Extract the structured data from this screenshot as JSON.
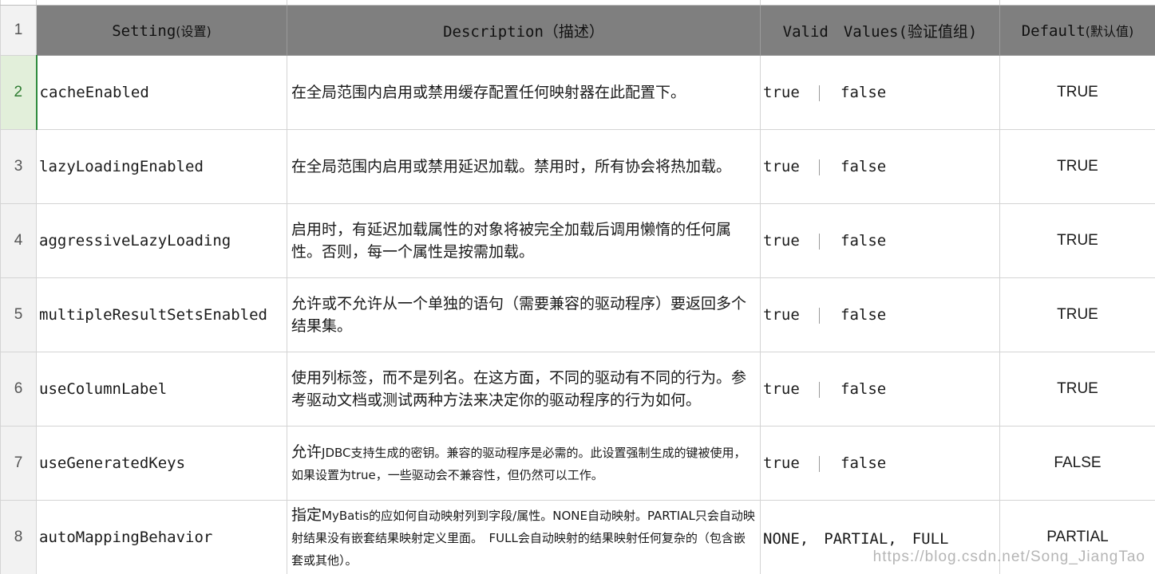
{
  "header": {
    "rownum": "1",
    "setting_main": "Setting",
    "setting_sub": "(设置)",
    "description": "Description（描述）",
    "valid": "Valid　Values(验证值组)",
    "default_main": "Default",
    "default_sub": "(默认值)"
  },
  "rows": [
    {
      "num": "2",
      "setting": "cacheEnabled",
      "description": "在全局范围内启用或禁用缓存配置任何映射器在此配置下。",
      "valid_a": "true",
      "valid_b": "false",
      "default": "TRUE"
    },
    {
      "num": "3",
      "setting": "lazyLoadingEnabled",
      "description": "在全局范围内启用或禁用延迟加载。禁用时，所有协会将热加载。",
      "valid_a": "true",
      "valid_b": "false",
      "default": "TRUE"
    },
    {
      "num": "4",
      "setting": "aggressiveLazyLoading",
      "description": "启用时，有延迟加载属性的对象将被完全加载后调用懒惰的任何属性。否则，每一个属性是按需加载。",
      "valid_a": "true",
      "valid_b": "false",
      "default": "TRUE"
    },
    {
      "num": "5",
      "setting": "multipleResultSetsEnabled",
      "description": "允许或不允许从一个单独的语句（需要兼容的驱动程序）要返回多个结果集。",
      "valid_a": "true",
      "valid_b": "false",
      "default": "TRUE"
    },
    {
      "num": "6",
      "setting": "useColumnLabel",
      "description": "使用列标签，而不是列名。在这方面，不同的驱动有不同的行为。参考驱动文档或测试两种方法来决定你的驱动程序的行为如何。",
      "valid_a": "true",
      "valid_b": "false",
      "default": "TRUE"
    },
    {
      "num": "7",
      "setting": "useGeneratedKeys",
      "description_lead": "允许",
      "description_rest": "JDBC支持生成的密钥。兼容的驱动程序是必需的。此设置强制生成的键被使用，如果设置为true，一些驱动会不兼容性，但仍然可以工作。",
      "valid_a": "true",
      "valid_b": "false",
      "default": "FALSE"
    },
    {
      "num": "8",
      "setting": "autoMappingBehavior",
      "description_lead": "指定",
      "description_rest": "MyBatis的应如何自动映射列到字段/属性。NONE自动映射。PARTIAL只会自动映射结果没有嵌套结果映射定义里面。　FULL会自动映射的结果映射任何复杂的（包含嵌套或其他）。",
      "valid_text": "NONE,　PARTIAL,　FULL",
      "default": "PARTIAL"
    }
  ],
  "watermark": "https://blog.csdn.net/Song_JiangTao"
}
